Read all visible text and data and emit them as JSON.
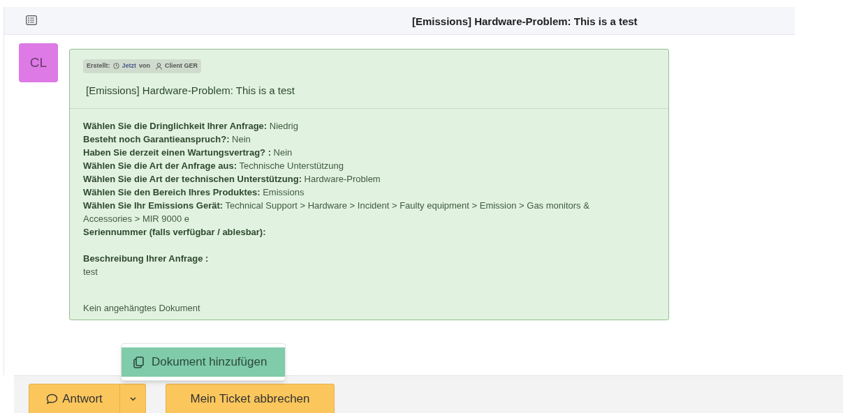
{
  "header": {
    "title": "[Emissions] Hardware-Problem: This is a test"
  },
  "message": {
    "avatar": "CL",
    "meta": {
      "created_label": "Erstellt:",
      "time": "Jetzt",
      "by": "von",
      "author": "Client GER"
    },
    "subject": "[Emissions] Hardware-Problem: This is a test",
    "fields": [
      {
        "kind": "inline",
        "label": "Wählen Sie die Dringlichkeit Ihrer Anfrage:",
        "value": "Niedrig"
      },
      {
        "kind": "inline",
        "label": "Besteht noch Garantieanspruch?:",
        "value": "Nein"
      },
      {
        "kind": "inline",
        "label": "Haben Sie derzeit einen Wartungsvertrag? :",
        "value": "Nein"
      },
      {
        "kind": "inline",
        "label": "Wählen Sie die Art der Anfrage aus:",
        "value": "Technische Unterstützung"
      },
      {
        "kind": "inline",
        "label": "Wählen Sie die Art der technischen Unterstützung:",
        "value": "Hardware-Problem"
      },
      {
        "kind": "inline",
        "label": "Wählen Sie den Bereich Ihres Produktes:",
        "value": "Emissions"
      },
      {
        "kind": "inline",
        "label": "Wählen Sie Ihr Emissions Gerät:",
        "value": "Technical Support > Hardware > Incident > Faulty equipment > Emission > Gas monitors & Accessories > MIR 9000 e"
      },
      {
        "kind": "inline",
        "label": "Seriennummer (falls verfügbar / ablesbar):"
      },
      {
        "kind": "block",
        "label": "Beschreibung Ihrer Anfrage :",
        "value": "test"
      }
    ],
    "attachments": "Kein angehängtes Dokument"
  },
  "menu": {
    "items": [
      "Dokument hinzufügen"
    ]
  },
  "buttons": {
    "reply": "Antwort",
    "cancel": "Mein Ticket abbrechen"
  }
}
